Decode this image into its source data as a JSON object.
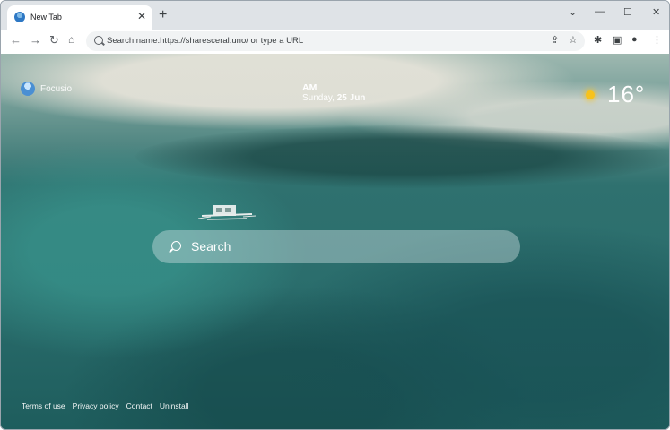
{
  "browser": {
    "tab": {
      "title": "New Tab"
    },
    "new_tab_glyph": "+",
    "window_controls": {
      "chevron": "⌄",
      "minimize": "—",
      "maximize": "☐",
      "close": "✕"
    },
    "omnibox": {
      "placeholder": "Search name.https://sharesceral.uno/ or type a URL"
    }
  },
  "page": {
    "logo_text": "Focusio",
    "clock": {
      "ampm": "AM",
      "weekday": "Sunday, ",
      "date": "25 Jun"
    },
    "weather": {
      "temperature": "16°",
      "icon": "sun-icon"
    },
    "search": {
      "label": "Search"
    },
    "footer_links": [
      "Terms of use",
      "Privacy policy",
      "Contact",
      "Uninstall"
    ]
  },
  "colors": {
    "accent_sun": "#f7c21b",
    "toolbar_bg": "#ffffff",
    "tabstrip_bg": "#dfe3e7"
  }
}
